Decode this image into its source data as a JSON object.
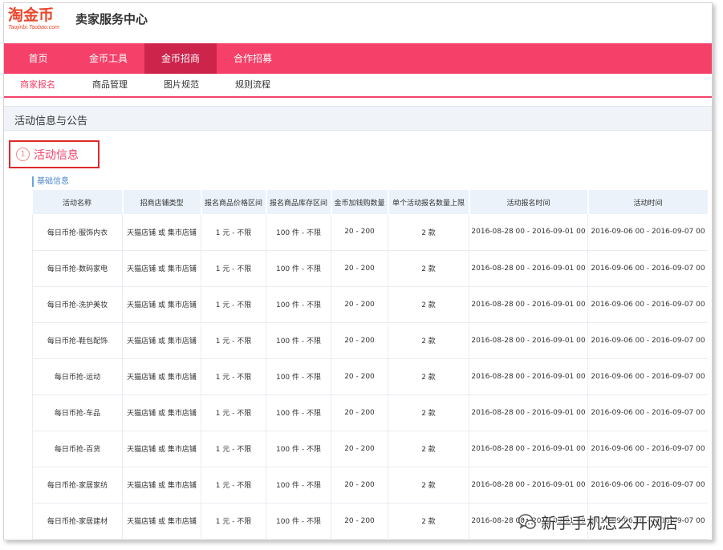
{
  "header": {
    "logo_text": "淘金币",
    "logo_sub": "Taojinbi.Taobao.com",
    "site_title": "卖家服务中心"
  },
  "nav": {
    "items": [
      {
        "label": "首页",
        "active": false
      },
      {
        "label": "金币工具",
        "active": false
      },
      {
        "label": "金币招商",
        "active": true
      },
      {
        "label": "合作招募",
        "active": false
      }
    ]
  },
  "subnav": {
    "items": [
      {
        "label": "商家报名",
        "active": true
      },
      {
        "label": "商品管理",
        "active": false
      },
      {
        "label": "图片规范",
        "active": false
      },
      {
        "label": "规则流程",
        "active": false
      }
    ]
  },
  "section": {
    "title": "活动信息与公告"
  },
  "activity": {
    "step": "1",
    "title": "活动信息",
    "basic_label": "基础信息"
  },
  "table": {
    "headers": [
      "活动名称",
      "招商店铺类型",
      "报名商品价格区间",
      "报名商品库存区间",
      "金币加钱购数量",
      "单个活动报名数量上限",
      "活动报名时间",
      "活动时间"
    ],
    "rows": [
      [
        "每日币抢-服饰内衣",
        "天猫店铺 或 集市店铺",
        "1 元 - 不限",
        "100 件 - 不限",
        "20 - 200",
        "2 款",
        "2016-08-28 00 - 2016-09-01 00",
        "2016-09-06 00 - 2016-09-07 00"
      ],
      [
        "每日币抢-数码家电",
        "天猫店铺 或 集市店铺",
        "1 元 - 不限",
        "100 件 - 不限",
        "20 - 200",
        "2 款",
        "2016-08-28 00 - 2016-09-01 00",
        "2016-09-06 00 - 2016-09-07 00"
      ],
      [
        "每日币抢-洗护美妆",
        "天猫店铺 或 集市店铺",
        "1 元 - 不限",
        "100 件 - 不限",
        "20 - 200",
        "2 款",
        "2016-08-28 00 - 2016-09-01 00",
        "2016-09-06 00 - 2016-09-07 00"
      ],
      [
        "每日币抢-鞋包配饰",
        "天猫店铺 或 集市店铺",
        "1 元 - 不限",
        "100 件 - 不限",
        "20 - 200",
        "2 款",
        "2016-08-28 00 - 2016-09-01 00",
        "2016-09-06 00 - 2016-09-07 00"
      ],
      [
        "每日币抢-运动",
        "天猫店铺 或 集市店铺",
        "1 元 - 不限",
        "100 件 - 不限",
        "20 - 200",
        "2 款",
        "2016-08-28 00 - 2016-09-01 00",
        "2016-09-06 00 - 2016-09-07 00"
      ],
      [
        "每日币抢-车品",
        "天猫店铺 或 集市店铺",
        "1 元 - 不限",
        "100 件 - 不限",
        "20 - 200",
        "2 款",
        "2016-08-28 00 - 2016-09-01 00",
        "2016-09-06 00 - 2016-09-07 00"
      ],
      [
        "每日币抢-百货",
        "天猫店铺 或 集市店铺",
        "1 元 - 不限",
        "100 件 - 不限",
        "20 - 200",
        "2 款",
        "2016-08-28 00 - 2016-09-01 00",
        "2016-09-06 00 - 2016-09-07 00"
      ],
      [
        "每日币抢-家居家纺",
        "天猫店铺 或 集市店铺",
        "1 元 - 不限",
        "100 件 - 不限",
        "20 - 200",
        "2 款",
        "2016-08-28 00 - 2016-09-01 00",
        "2016-09-06 00 - 2016-09-07 00"
      ],
      [
        "每日币抢-家居建材",
        "天猫店铺 或 集市店铺",
        "1 元 - 不限",
        "100 件 - 不限",
        "20 - 200",
        "2 款",
        "2016-08-28 00 - 2016-09-01 00",
        "2016-09-06 00 - 2016-09-07 00"
      ]
    ]
  },
  "watermark": {
    "text": "新手手机怎么开网店",
    "icon": "wechat-icon"
  },
  "colors": {
    "accent": "#f5416a",
    "nav_active": "#cd244c",
    "highlight_box": "#e0272b",
    "logo": "#e9462b",
    "link_blue": "#4b86c9"
  }
}
